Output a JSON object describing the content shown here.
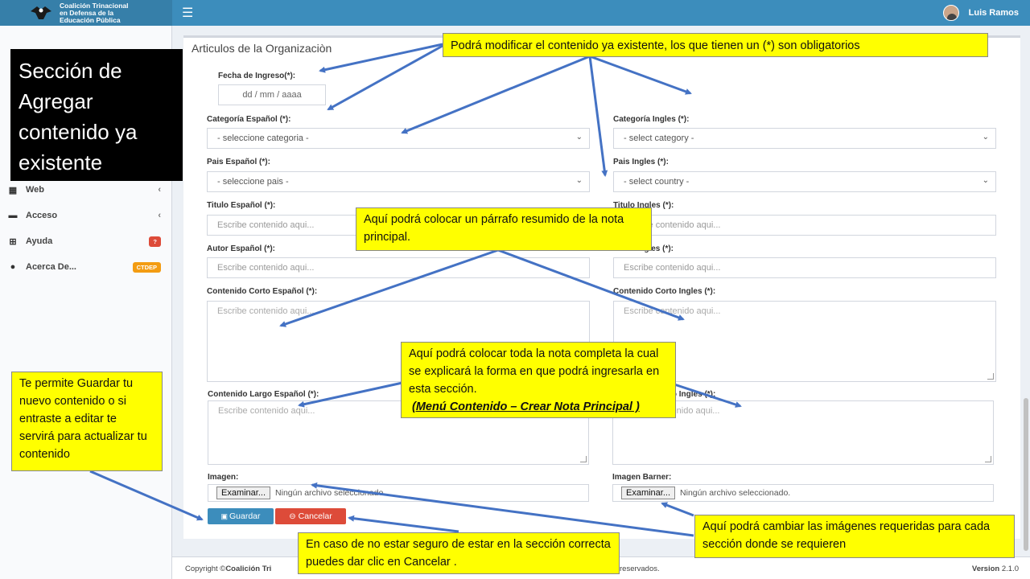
{
  "header": {
    "logo_line1": "Coalición Trinacional",
    "logo_line2": "en Defensa de la",
    "logo_line3": "Educación Pública",
    "menu_icon": "☰",
    "user_name": "Luis Ramos"
  },
  "sidebar": {
    "items": [
      {
        "label": "Web",
        "icon": "grid-icon",
        "glyph": "▦",
        "arrow": "‹"
      },
      {
        "label": "Acceso",
        "icon": "folder-icon",
        "glyph": "▬",
        "arrow": "‹"
      },
      {
        "label": "Ayuda",
        "icon": "plus-square-icon",
        "glyph": "⊞",
        "badge": "?",
        "badge_color": "#dd4b39"
      },
      {
        "label": "Acerca De...",
        "icon": "info-icon",
        "glyph": "●",
        "badge": "CTDEP",
        "badge_color": "#f39c12"
      }
    ]
  },
  "callout_left": "Sección de Agregar contenido ya existente",
  "form": {
    "title": "Articulos de la Organizaciòn",
    "fecha_label": "Fecha de Ingreso(*):",
    "fecha_placeholder": "dd / mm / aaaa",
    "cat_es_label": "Categoría Español (*):",
    "cat_es_value": "- seleccione categoria -",
    "cat_en_label": "Categoría Ingles (*):",
    "cat_en_value": "- select category -",
    "pais_es_label": "Pais Español (*):",
    "pais_es_value": "- seleccione pais -",
    "pais_en_label": "Pais Ingles (*):",
    "pais_en_value": "- select country -",
    "titulo_es_label": "Titulo Español (*):",
    "titulo_en_label": "Titulo Ingles (*):",
    "autor_es_label": "Autor Español (*):",
    "autor_en_label": "Autor Ingles (*):",
    "corto_es_label": "Contenido Corto Español (*):",
    "corto_en_label": "Contenido Corto Ingles (*):",
    "largo_es_label": "Contenido Largo Español (*):",
    "largo_en_label": "Contenido Largo Ingles (*):",
    "placeholder": "Escribe contenido aqui...",
    "imagen_label": "Imagen:",
    "imagen_barner_label": "Imagen Barner:",
    "examinar": "Examinar...",
    "no_file": "Ningún archivo seleccionado.",
    "guardar": "Guardar",
    "cancelar": "Cancelar"
  },
  "footer": {
    "copyright_prefix": "Copyright ©",
    "copyright_org": "Coalición Tri",
    "reserved": "reservados.",
    "version_label": "Version",
    "version_value": "2.1.0"
  },
  "annotations": {
    "modify": "Podrá modificar el contenido ya existente, los que tienen un (*) son obligatorios",
    "paragraph": "Aquí podrá colocar un párrafo resumido de la nota principal.",
    "full_note_line1": "Aquí podrá colocar toda la nota completa la cual se explicará la forma en que podrá ingresarla en esta sección.",
    "full_note_line2": "(Menú Contenido – Crear Nota Principal )",
    "save": "Te permite Guardar tu nuevo contenido o si entraste a editar te servirá para actualizar tu contenido",
    "cancel": "En caso de no estar seguro de estar en la sección correcta puedes dar clic en Cancelar .",
    "images": "Aquí podrá cambiar las imágenes requeridas para cada sección donde se requieren"
  },
  "colors": {
    "header_blue": "#3c8dbc",
    "save_blue": "#3c8dbc",
    "cancel_red": "#dd4b39",
    "callout_yellow": "#ffff00",
    "arrow_blue": "#4472c4"
  }
}
